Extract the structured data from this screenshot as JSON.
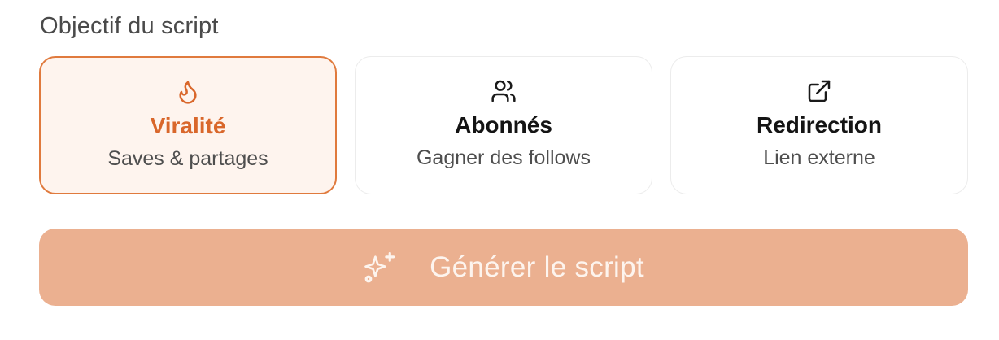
{
  "section": {
    "label": "Objectif du script"
  },
  "options": [
    {
      "icon": "flame-icon",
      "title": "Viralité",
      "subtitle": "Saves & partages",
      "selected": true
    },
    {
      "icon": "users-icon",
      "title": "Abonnés",
      "subtitle": "Gagner des follows",
      "selected": false
    },
    {
      "icon": "external-link-icon",
      "title": "Redirection",
      "subtitle": "Lien externe",
      "selected": false
    }
  ],
  "generate": {
    "icon": "sparkles-icon",
    "label": "Générer le script"
  },
  "colors": {
    "accent": "#d9672b",
    "selected_border": "#e07a3d",
    "selected_bg": "#fef4ee",
    "button_bg": "#ebb090"
  }
}
